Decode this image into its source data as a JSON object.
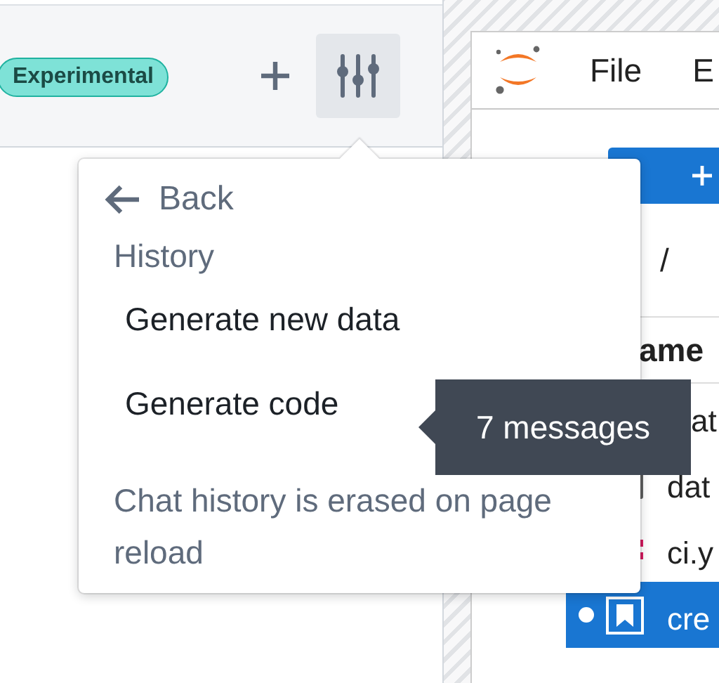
{
  "panel": {
    "badge": "Experimental",
    "toolbar": [
      {
        "kind": "add",
        "active": false
      },
      {
        "kind": "sliders",
        "active": true
      }
    ]
  },
  "menu": {
    "back": "Back",
    "heading": "History",
    "items": [
      "Generate new data",
      "Generate code"
    ],
    "note": "Chat history is erased on page reload"
  },
  "tooltip": "7 messages",
  "notebook": {
    "menu": [
      "File",
      "E"
    ],
    "path": "/",
    "column": "ame",
    "files": [
      {
        "name": "at",
        "kind": "covered",
        "selected": false
      },
      {
        "name": "dat",
        "kind": "notebook",
        "selected": false
      },
      {
        "name": "ci.y",
        "kind": "yaml",
        "selected": false
      },
      {
        "name": "cre",
        "kind": "bookmark",
        "selected": true
      }
    ]
  }
}
